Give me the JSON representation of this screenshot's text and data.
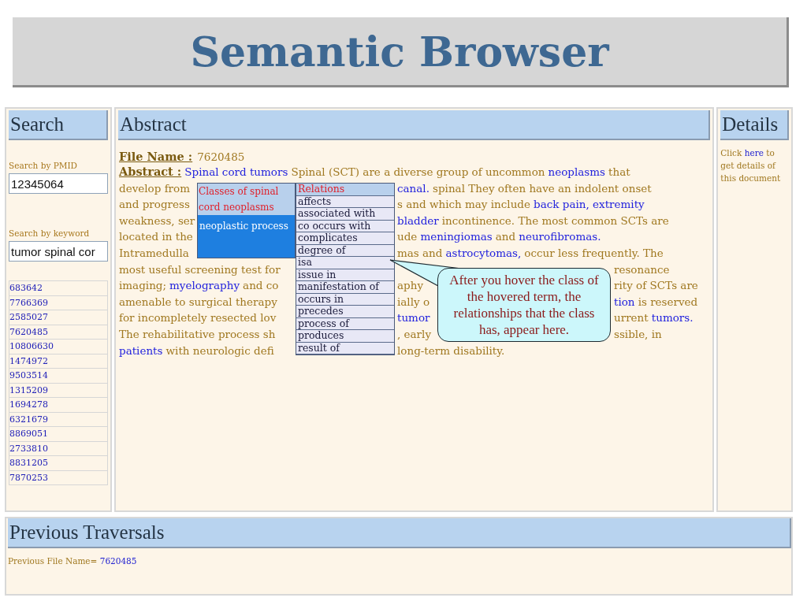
{
  "header": {
    "title": "Semantic Browser"
  },
  "search": {
    "heading": "Search",
    "pmid_label": "Search by PMID",
    "pmid_value": "12345064",
    "keyword_label": "Search by keyword",
    "keyword_value": "tumor spinal cor",
    "results": [
      "683642",
      "7766369",
      "2585027",
      "7620485",
      "10806630",
      "1474972",
      "9503514",
      "1315209",
      "1694278",
      "6321679",
      "8869051",
      "2733810",
      "8831205",
      "7870253"
    ]
  },
  "abstract": {
    "heading": "Abstract",
    "file_label": "File Name :",
    "file_value": "7620485",
    "lines": [
      {
        "groups": [
          [
            {
              "kind": "label",
              "text": "Abstract :"
            },
            {
              "kind": "link",
              "text": "Spinal cord tumors"
            },
            {
              "kind": "text",
              "text": "Spinal (SCT) are a diverse group of uncommon"
            },
            {
              "kind": "link",
              "text": "neoplasms"
            },
            {
              "kind": "text",
              "text": "that"
            }
          ]
        ]
      },
      {
        "groups": [
          [
            {
              "kind": "text",
              "text": "develop from"
            }
          ],
          [
            {
              "kind": "link",
              "text": "canal."
            },
            {
              "kind": "text",
              "text": "spinal They often have an indolent onset"
            }
          ]
        ]
      },
      {
        "groups": [
          [
            {
              "kind": "text",
              "text": "and progress"
            }
          ],
          [
            {
              "kind": "text",
              "text": "s and which may include"
            },
            {
              "kind": "link",
              "text": "back pain, extremity"
            }
          ]
        ]
      },
      {
        "groups": [
          [
            {
              "kind": "text",
              "text": "weakness, ser"
            }
          ],
          [
            {
              "kind": "link",
              "text": "bladder"
            },
            {
              "kind": "text",
              "text": "incontinence. The most common SCTs are"
            }
          ]
        ]
      },
      {
        "groups": [
          [
            {
              "kind": "text",
              "text": "located in the"
            }
          ],
          [
            {
              "kind": "text",
              "text": "ude"
            },
            {
              "kind": "link",
              "text": "meningiomas"
            },
            {
              "kind": "text",
              "text": "and"
            },
            {
              "kind": "link",
              "text": "neurofibromas."
            }
          ]
        ]
      },
      {
        "groups": [
          [
            {
              "kind": "text",
              "text": "Intramedulla"
            }
          ],
          [
            {
              "kind": "text",
              "text": "mas and"
            },
            {
              "kind": "link",
              "text": "astrocytomas,"
            },
            {
              "kind": "text",
              "text": "occur less frequently. The"
            }
          ]
        ]
      },
      {
        "kind": "callout",
        "groups": [
          [
            {
              "kind": "text",
              "text": "most useful screening test for"
            }
          ],
          [
            {
              "kind": "text",
              "text": "resonance"
            }
          ]
        ]
      },
      {
        "groups": [
          [
            {
              "kind": "text",
              "text": "imaging;"
            },
            {
              "kind": "link",
              "text": "myelography"
            },
            {
              "kind": "text",
              "text": "and co"
            }
          ],
          [
            {
              "kind": "text",
              "text": "aphy"
            }
          ],
          [
            {
              "kind": "text",
              "text": "rity of SCTs are"
            }
          ]
        ]
      },
      {
        "groups": [
          [
            {
              "kind": "text",
              "text": "amenable to surgical therapy"
            }
          ],
          [
            {
              "kind": "text",
              "text": "ially o"
            }
          ],
          [
            {
              "kind": "link",
              "text": "tion"
            },
            {
              "kind": "text",
              "text": "is reserved"
            }
          ]
        ]
      },
      {
        "groups": [
          [
            {
              "kind": "text",
              "text": "for incompletely resected lov"
            }
          ],
          [
            {
              "kind": "link",
              "text": "tumor"
            }
          ],
          [
            {
              "kind": "text",
              "text": "urrent"
            },
            {
              "kind": "link",
              "text": "tumors."
            }
          ]
        ]
      },
      {
        "groups": [
          [
            {
              "kind": "text",
              "text": "The rehabilitative process sh"
            }
          ],
          [
            {
              "kind": "text",
              "text": ", early"
            }
          ],
          [
            {
              "kind": "text",
              "text": "ssible, in"
            }
          ]
        ]
      },
      {
        "groups": [
          [
            {
              "kind": "link",
              "text": "patients"
            },
            {
              "kind": "text",
              "text": "with neurologic defi"
            }
          ],
          [
            {
              "kind": "text",
              "text": "long-term disability."
            }
          ]
        ]
      }
    ]
  },
  "classes_popup": {
    "title": "Classes of spinal cord neoplasms",
    "items": [
      {
        "label": "neoplastic process",
        "selected": true
      }
    ]
  },
  "relations_popup": {
    "title": "Relations",
    "items": [
      "affects",
      "associated with",
      "co occurs with",
      "complicates",
      "degree of",
      "isa",
      "issue in",
      "manifestation of",
      "occurs in",
      "precedes",
      "process of",
      "produces",
      "result of"
    ]
  },
  "callout": {
    "text": "After you hover the class of the hovered term, the relationships that the class has, appear here."
  },
  "details": {
    "heading": "Details",
    "before": "Click",
    "link": "here",
    "after": "to get details of this document"
  },
  "previous": {
    "heading": "Previous Traversals",
    "label": "Previous File Name=",
    "link": "7620485"
  }
}
